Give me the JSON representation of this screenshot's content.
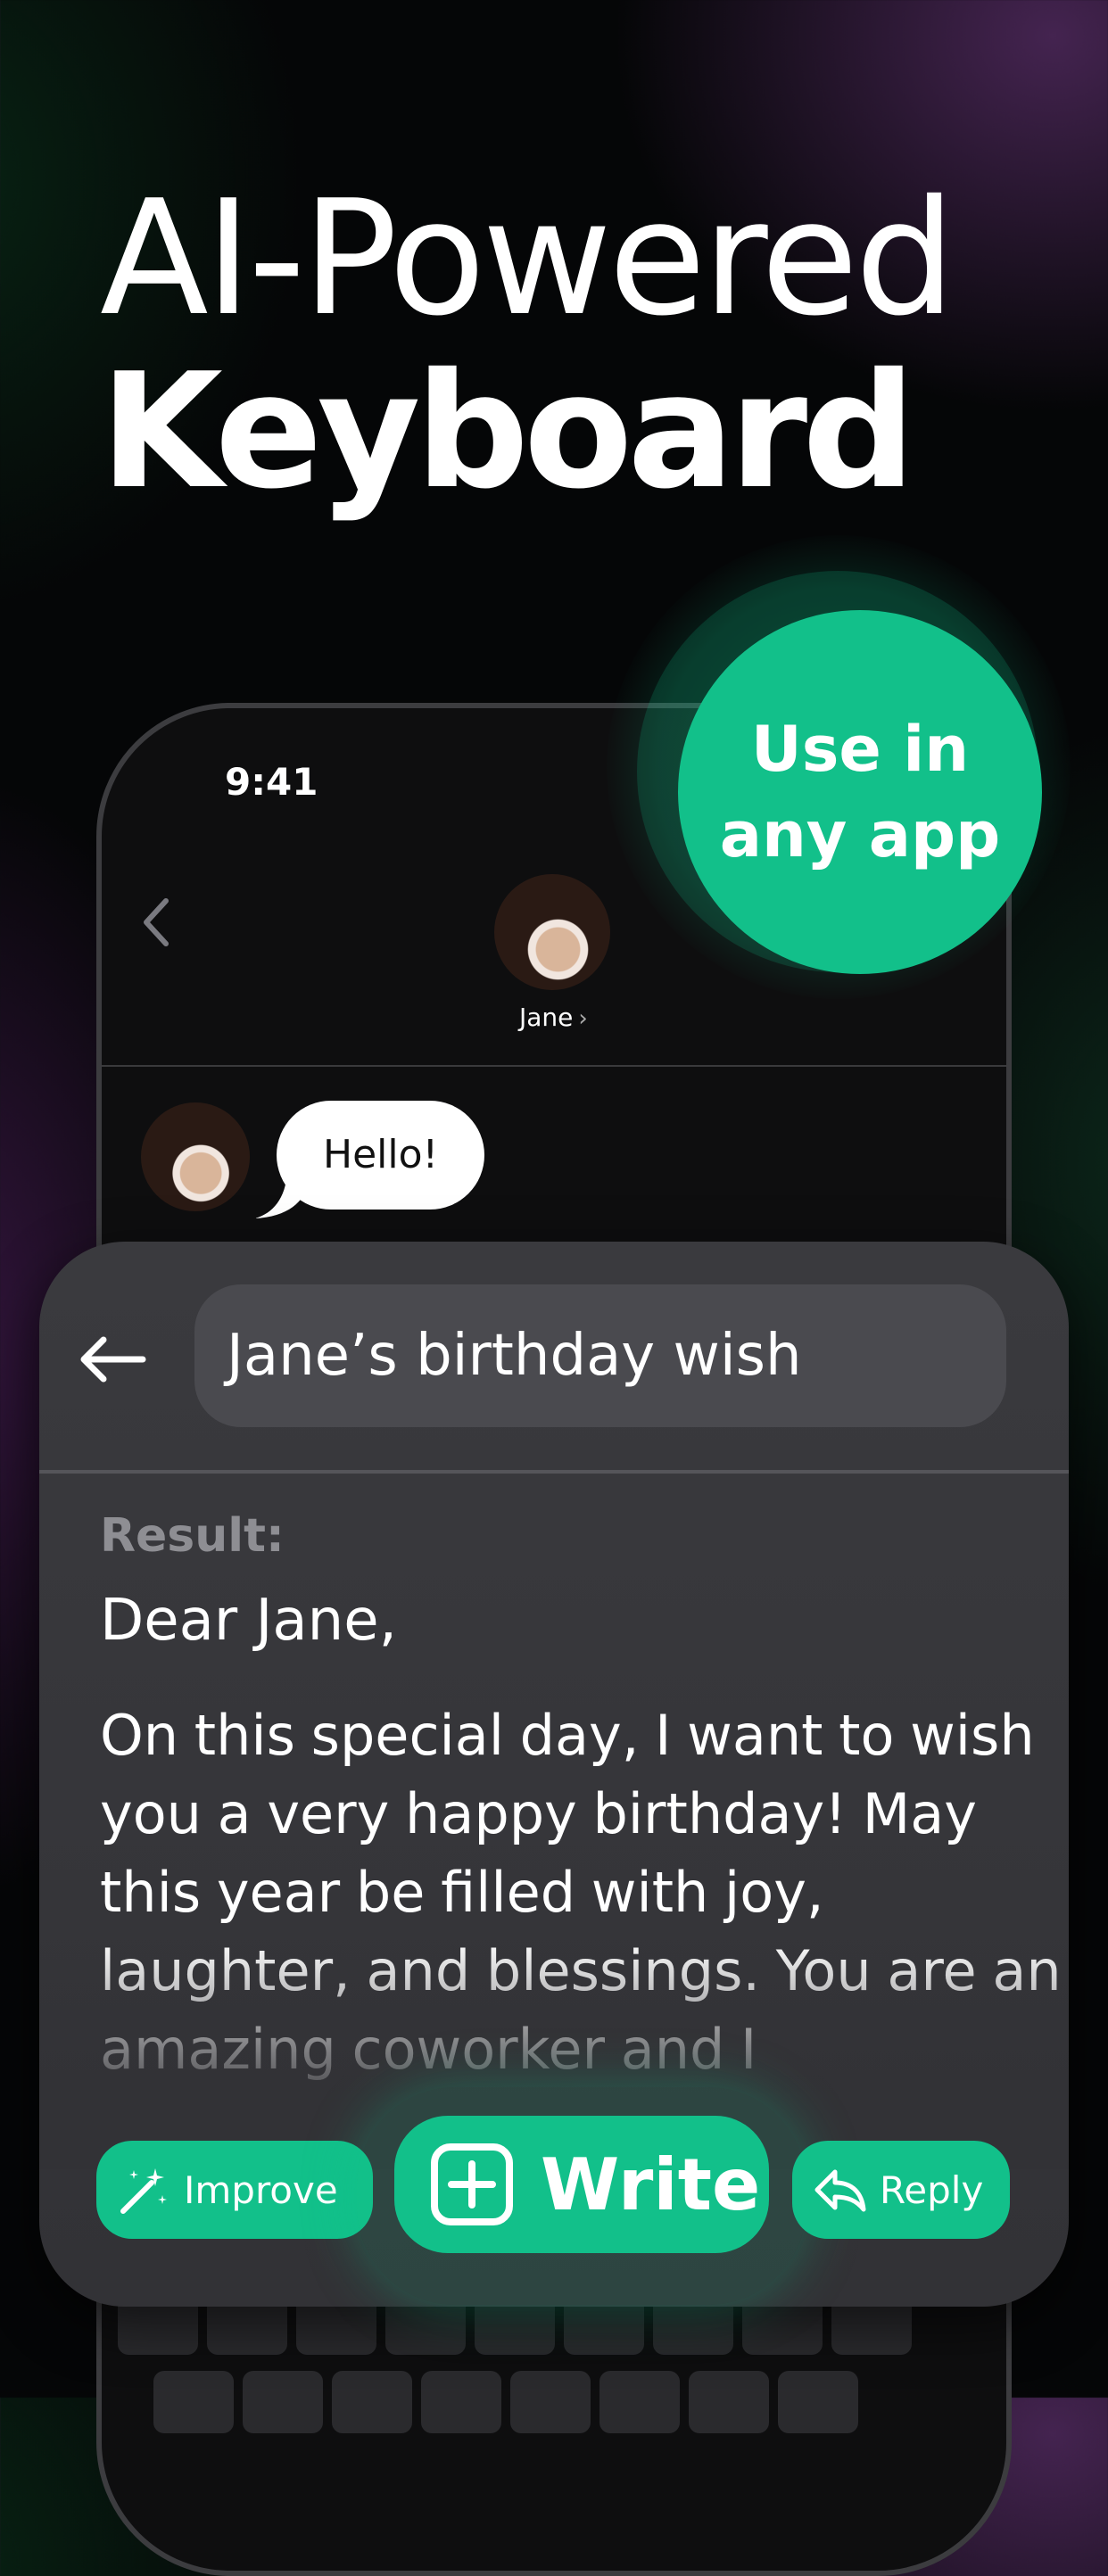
{
  "headline": {
    "line1": "AI-Powered",
    "line2": "Keyboard"
  },
  "badge": {
    "line1": "Use in",
    "line2": "any app"
  },
  "phone": {
    "status_time": "9:41",
    "contact_name": "Jane",
    "message": "Hello!"
  },
  "panel": {
    "prompt_value": "Jane’s birthday wish",
    "result_label": "Result:",
    "greeting": "Dear Jane,",
    "body": "On this special day, I want to wish you a very happy birthday! May this year be filled with joy, laughter, and blessings. You are an amazing coworker and I",
    "buttons": {
      "improve": "Improve",
      "write": "Write",
      "reply": "Reply"
    }
  },
  "colors": {
    "accent": "#12c08a",
    "panel": "#3a3a3e",
    "background": "#050607"
  },
  "icons": [
    "chevron-left-icon",
    "arrow-left-icon",
    "magic-wand-icon",
    "plus-square-icon",
    "reply-arrow-icon",
    "chevron-right-icon"
  ]
}
